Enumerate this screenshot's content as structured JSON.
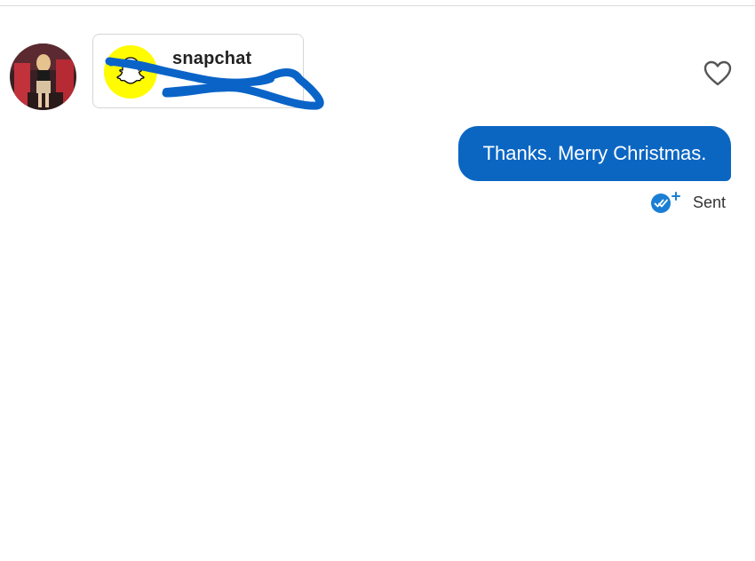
{
  "card": {
    "title": "snapchat",
    "logo_icon": "snapchat-ghost-icon"
  },
  "actions": {
    "like_icon": "heart-outline-icon"
  },
  "message": {
    "text": "Thanks. Merry Christmas.",
    "status_text": "Sent",
    "status_icon": "double-check-plus-icon",
    "bubble_color": "#0b66c2"
  },
  "colors": {
    "snapchat_yellow": "#fffc00",
    "scribble_blue": "#0a64c8"
  }
}
